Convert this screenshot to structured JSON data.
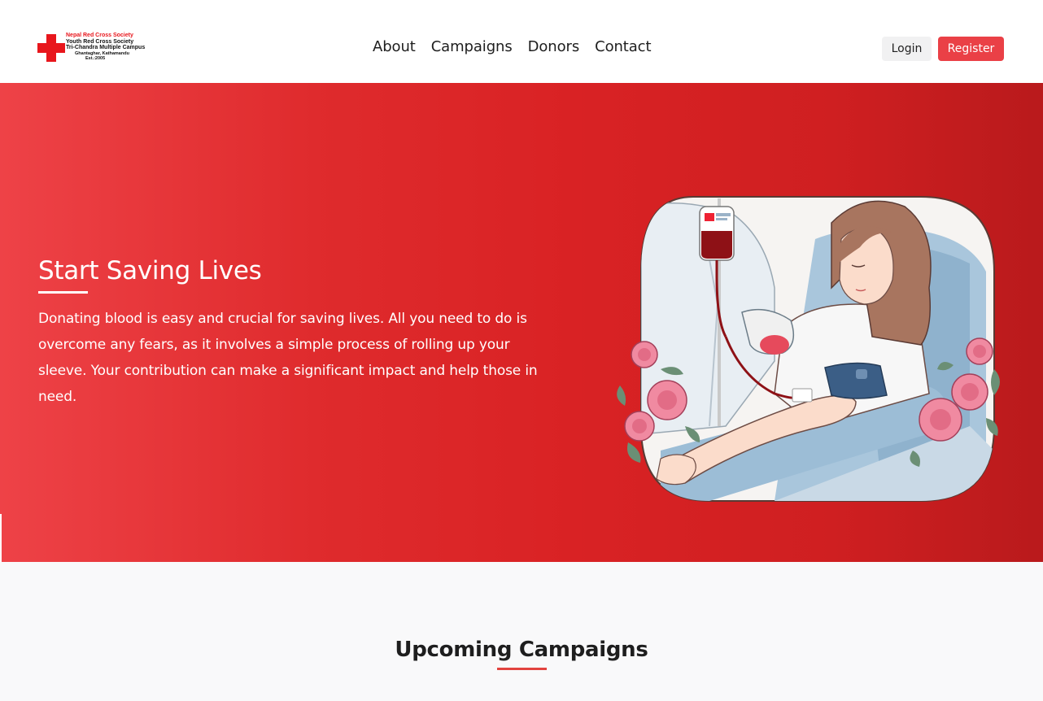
{
  "logo": {
    "lines": [
      "Nepal Red Cross Society",
      "Youth Red Cross Society",
      "Tri-Chandra Multiple Campus",
      "Ghantaghar, Kathamandu",
      "Est.:2005"
    ]
  },
  "nav": {
    "links": [
      "About",
      "Campaigns",
      "Donors",
      "Contact"
    ],
    "login_label": "Login",
    "register_label": "Register"
  },
  "hero": {
    "title": "Start Saving Lives",
    "text": "Donating blood is easy and crucial for saving lives. All you need to do is overcome any fears, as it involves a simple process of rolling up your sleeve. Your contribution can make a significant impact and help those in need."
  },
  "campaigns": {
    "title": "Upcoming Campaigns"
  },
  "colors": {
    "brand_red": "#ea4046",
    "hero_gradient_start": "#ee4247",
    "hero_gradient_end": "#b91a1c",
    "cross_red": "#e8161c"
  }
}
